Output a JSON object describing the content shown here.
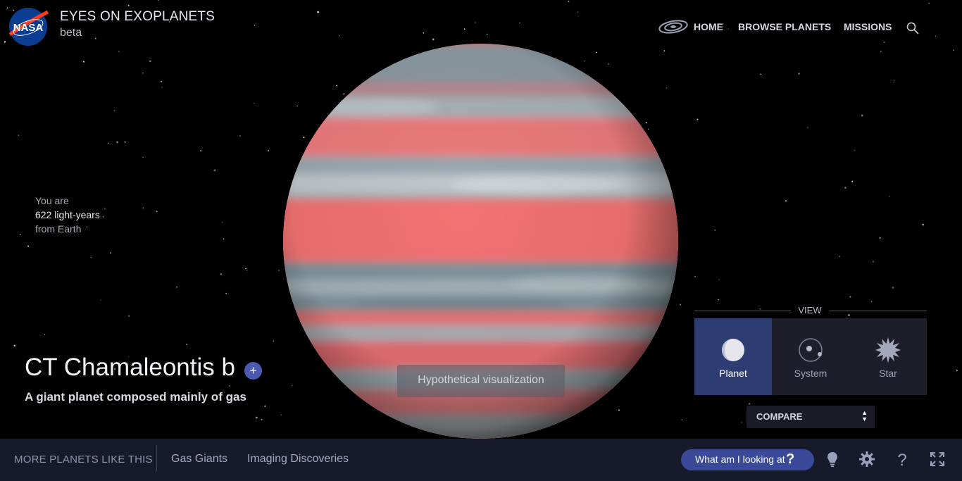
{
  "header": {
    "logo_text": "NASA",
    "title": "EYES ON EXOPLANETS",
    "subtitle": "beta",
    "nav": {
      "home": "HOME",
      "browse": "BROWSE PLANETS",
      "missions": "MISSIONS"
    }
  },
  "distance": {
    "line1": "You are",
    "line2": "622 light-years",
    "line3": "from Earth"
  },
  "planet": {
    "name": "CT Chamaleontis b",
    "add_symbol": "+",
    "description": "A giant planet composed mainly of gas",
    "visualization_note": "Hypothetical visualization"
  },
  "view_panel": {
    "title": "VIEW",
    "options": [
      {
        "label": "Planet",
        "icon": "planet-icon",
        "active": true
      },
      {
        "label": "System",
        "icon": "system-icon",
        "active": false
      },
      {
        "label": "Star",
        "icon": "star-icon",
        "active": false
      }
    ],
    "compare_label": "COMPARE"
  },
  "bottom_bar": {
    "more_label": "MORE PLANETS LIKE THIS",
    "links": [
      "Gas Giants",
      "Imaging Discoveries"
    ],
    "what_label": "What am I looking at",
    "what_symbol": "?"
  },
  "colors": {
    "background": "#000000",
    "accent": "#3a4a98",
    "active_view": "#2e3c74",
    "bottom_bar": "#171a2a",
    "planet_band_red": "#f07070",
    "planet_band_gray": "#8fa4ad"
  }
}
